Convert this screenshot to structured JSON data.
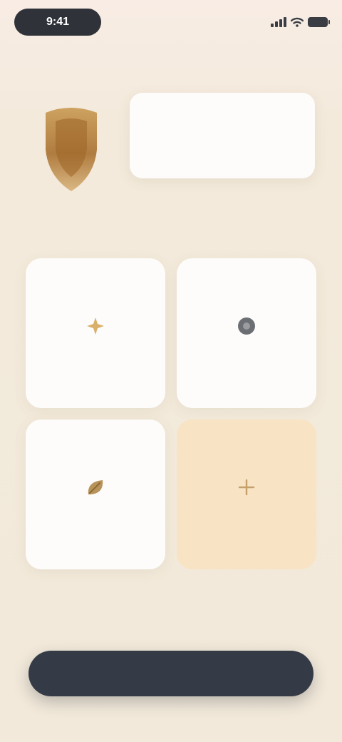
{
  "status_bar": {
    "time": "9:41"
  },
  "header": {
    "subtitle": ""
  },
  "info_card": {
    "title": "",
    "body": ""
  },
  "tiles": [
    {
      "label": "",
      "icon": "sparkle-icon"
    },
    {
      "label": "",
      "icon": "circle-icon"
    },
    {
      "label": "",
      "icon": "leaf-icon"
    },
    {
      "label": "",
      "icon": "plus-icon"
    }
  ],
  "primary_button": {
    "label": ""
  },
  "colors": {
    "background": "#f3eadb",
    "card": "#fdfcfa",
    "accent_tile": "#f8e4c4",
    "shield": "#b07a34",
    "button": "#353b46"
  }
}
